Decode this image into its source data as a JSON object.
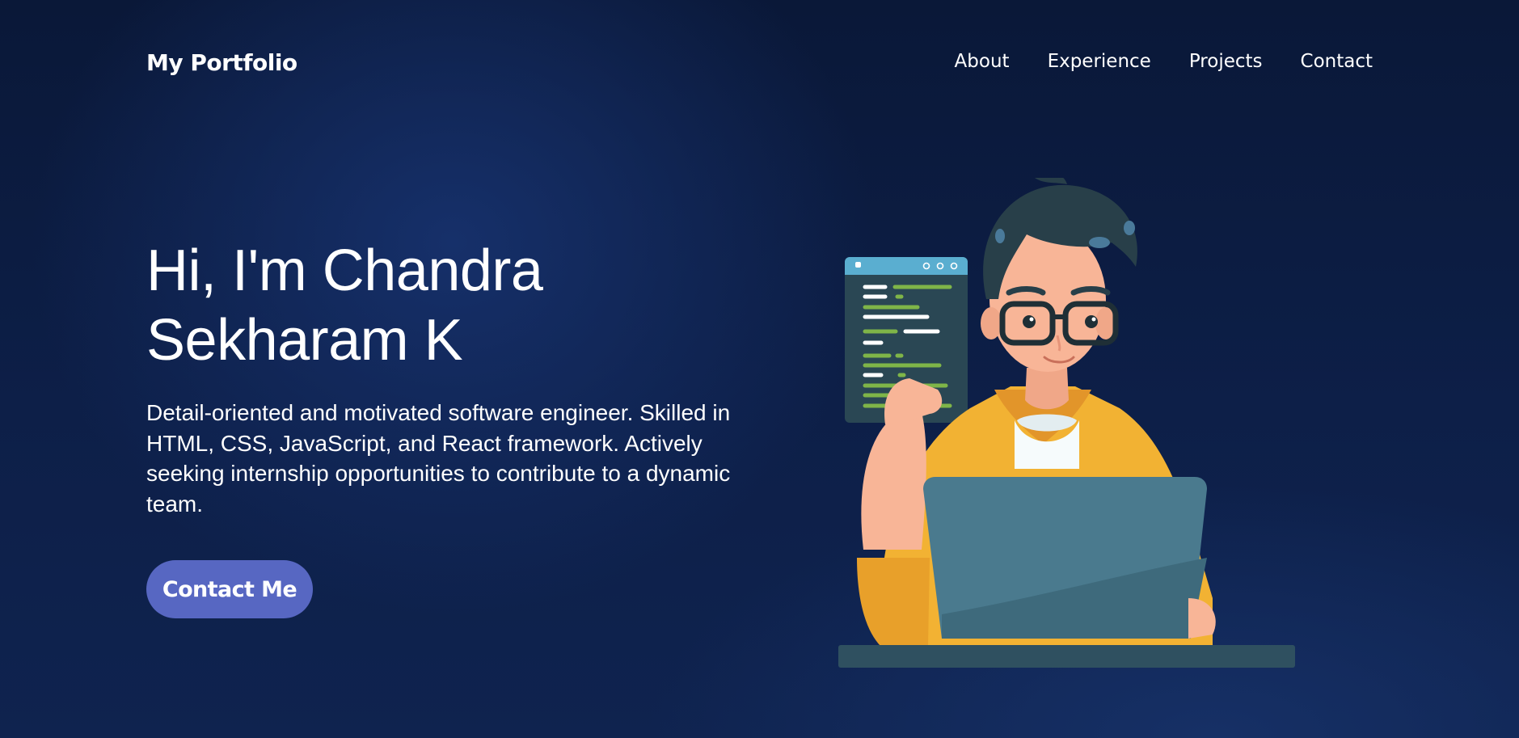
{
  "nav": {
    "brand": "My Portfolio",
    "links": [
      "About",
      "Experience",
      "Projects",
      "Contact"
    ]
  },
  "hero": {
    "title_line1": "Hi, I'm Chandra",
    "title_line2": "Sekharam K",
    "description": "Detail-oriented and motivated software engineer. Skilled in HTML, CSS, JavaScript, and React framework. Actively seeking internship opportunities to contribute to a dynamic team.",
    "cta_label": "Contact Me"
  },
  "illustration": {
    "icon": "developer-with-laptop-illustration"
  },
  "colors": {
    "background": "#0d1f48",
    "accent": "#5767c2",
    "hoodie": "#f2b233",
    "laptop": "#4a7a8e"
  }
}
